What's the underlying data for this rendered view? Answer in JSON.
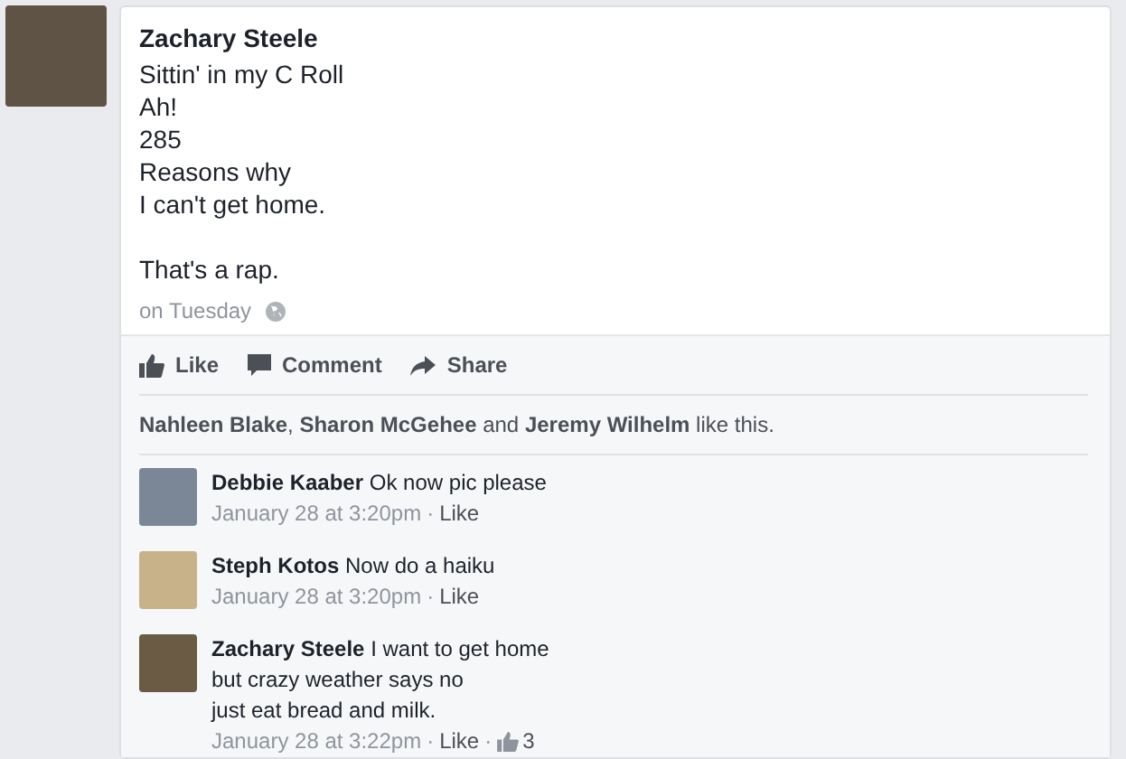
{
  "post": {
    "author": "Zachary Steele",
    "text": "Sittin' in my C Roll\nAh!\n285\nReasons why\nI can't get home.\n\nThat's a rap.",
    "time": "on Tuesday"
  },
  "actions": [
    {
      "kind": "like",
      "label": "Like"
    },
    {
      "kind": "comment",
      "label": "Comment"
    },
    {
      "kind": "share",
      "label": "Share"
    }
  ],
  "likes_summary": "**Nahleen Blake**, **Sharon McGehee** and **Jeremy Wilhelm** like this.",
  "comments": [
    {
      "author": "Debbie Kaaber",
      "text": "Ok now pic please",
      "time": "January 28 at 3:20pm",
      "separator": "·",
      "like": "Like"
    },
    {
      "author": "Steph Kotos",
      "text": "Now do a haiku",
      "time": "January 28 at 3:20pm",
      "separator": "·",
      "like": "Like"
    },
    {
      "author": "Zachary Steele",
      "text": "I want to get home\nbut crazy weather says no\njust eat bread and milk.",
      "time": "January 28 at 3:22pm",
      "separator": "·",
      "like": "Like",
      "likes_separator": "·",
      "likes_count": "3"
    }
  ]
}
